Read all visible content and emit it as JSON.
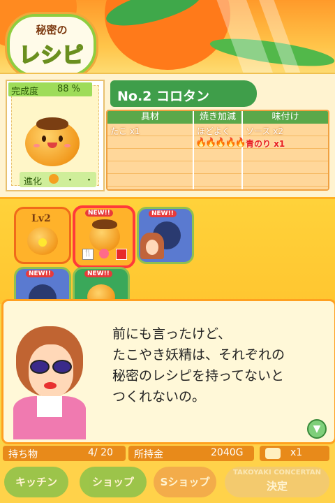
{
  "logo": {
    "line1": "秘密の",
    "line2": "レシピ"
  },
  "progress": {
    "label": "完成度",
    "value": "88 %"
  },
  "evolution": {
    "label": "進化",
    "dots": "・・"
  },
  "recipe": {
    "name": "No.2 コロタン",
    "headers": [
      "具材",
      "焼き加減",
      "味付け"
    ],
    "ingredient": "たこ x1",
    "bake": "ほどよく",
    "sauce1": "ソース x2",
    "sauce2": "青のり x1",
    "flames_lit": 3,
    "flames_total": 5
  },
  "grid": {
    "slot1_level": "Lv2",
    "new_badge": "NEW!!"
  },
  "dialog": {
    "lines": [
      "前にも言ったけど、",
      "たこやき妖精は、それぞれの",
      "秘密のレシピを持ってないと",
      "つくれないの。"
    ]
  },
  "status": {
    "items_label": "持ち物",
    "items_value": "4/ 20",
    "money_label": "所持金",
    "money_value": "2040G",
    "ticket_value": "x1"
  },
  "buttons": {
    "kitchen": "キッチン",
    "shop": "ショップ",
    "sshop": "Sショップ",
    "decide": "決定",
    "decide_bg": "TAKOYAKI CONCERTAN"
  },
  "colors": {
    "green": "#3f9e4a",
    "orange": "#ffa020",
    "yellow": "#ffd24a"
  }
}
